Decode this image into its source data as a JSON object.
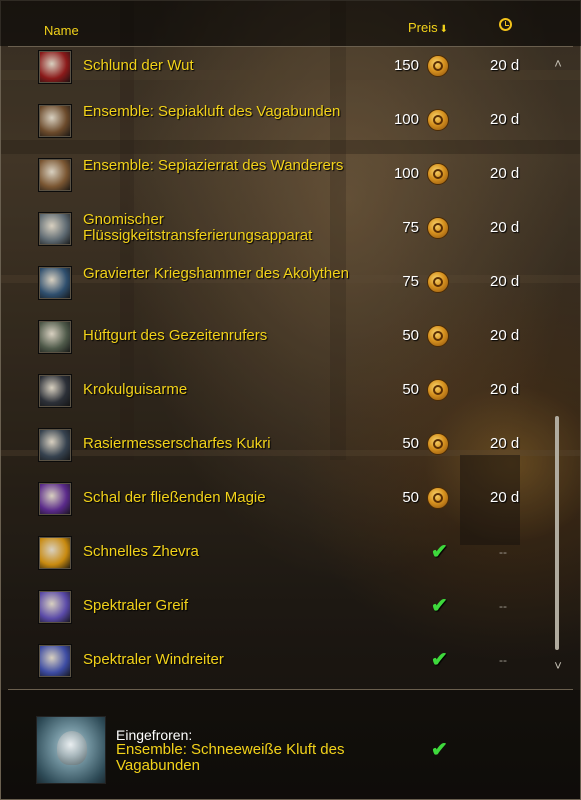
{
  "header": {
    "name_label": "Name",
    "price_label": "Preis",
    "sort_arrow": "⬇",
    "clock_icon": "clock-icon"
  },
  "items": [
    {
      "name": "Schlund der Wut",
      "price": "150",
      "duration": "20 d",
      "icon": "red-demon-maw-icon",
      "icon_color": "#8b1a1a"
    },
    {
      "name": "Ensemble: Sepiakluft des Vagabunden",
      "price": "100",
      "duration": "20 d",
      "icon": "brown-cloak-icon",
      "icon_color": "#6b4a2b"
    },
    {
      "name": "Ensemble: Sepiazierrat des Wanderers",
      "price": "100",
      "duration": "20 d",
      "icon": "brown-rope-bundle-icon",
      "icon_color": "#7a5632"
    },
    {
      "name": "Gnomischer Flüssigkeitstransferierungsapparat",
      "price": "75",
      "duration": "20 d",
      "icon": "gnomish-device-icon",
      "icon_color": "#5e6a72"
    },
    {
      "name": "Gravierter Kriegshammer des Akolythen",
      "price": "75",
      "duration": "20 d",
      "icon": "warhammer-icon",
      "icon_color": "#2f4f6e"
    },
    {
      "name": "Hüftgurt des Gezeitenrufers",
      "price": "50",
      "duration": "20 d",
      "icon": "belt-buckle-icon",
      "icon_color": "#4f5a4a"
    },
    {
      "name": "Krokulguisarme",
      "price": "50",
      "duration": "20 d",
      "icon": "polearm-icon",
      "icon_color": "#2c3038"
    },
    {
      "name": "Rasiermesserscharfes Kukri",
      "price": "50",
      "duration": "20 d",
      "icon": "kukri-blade-icon",
      "icon_color": "#36424f"
    },
    {
      "name": "Schal der fließenden Magie",
      "price": "50",
      "duration": "20 d",
      "icon": "purple-cloak-icon",
      "icon_color": "#5a2a8a"
    },
    {
      "name": "Schnelles Zhevra",
      "price": "",
      "duration": "--",
      "icon": "golden-sun-icon",
      "icon_color": "#c88a10",
      "owned": true
    },
    {
      "name": "Spektraler Greif",
      "price": "",
      "duration": "--",
      "icon": "spectral-gryphon-icon",
      "icon_color": "#5a4aa8",
      "owned": true
    },
    {
      "name": "Spektraler Windreiter",
      "price": "",
      "duration": "--",
      "icon": "spectral-windrider-icon",
      "icon_color": "#3d4ca3",
      "owned": true
    }
  ],
  "footer": {
    "frozen_label": "Eingefroren:",
    "frozen_item": "Ensemble: Schneeweiße Kluft des Vagabunden",
    "frozen_icon": "snowy-cloak-icon"
  },
  "scrollbar": {
    "up_glyph": "˄",
    "down_glyph": "˅",
    "position_fraction": 0.72
  },
  "colors": {
    "item_gold": "#f2d21a",
    "check_green": "#3ed93c"
  }
}
